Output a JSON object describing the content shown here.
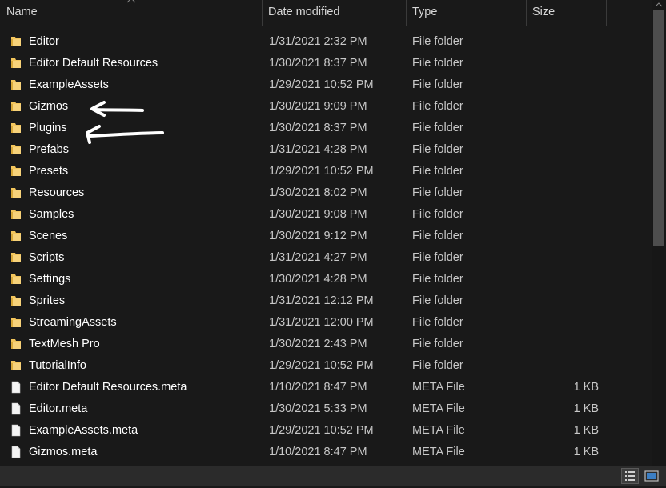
{
  "columns": {
    "name": "Name",
    "date": "Date modified",
    "type": "Type",
    "size": "Size"
  },
  "files": [
    {
      "name": "Editor",
      "date": "1/31/2021 2:32 PM",
      "type": "File folder",
      "size": "",
      "icon": "folder-icon"
    },
    {
      "name": "Editor Default Resources",
      "date": "1/30/2021 8:37 PM",
      "type": "File folder",
      "size": "",
      "icon": "folder-icon"
    },
    {
      "name": "ExampleAssets",
      "date": "1/29/2021 10:52 PM",
      "type": "File folder",
      "size": "",
      "icon": "folder-icon"
    },
    {
      "name": "Gizmos",
      "date": "1/30/2021 9:09 PM",
      "type": "File folder",
      "size": "",
      "icon": "folder-icon"
    },
    {
      "name": "Plugins",
      "date": "1/30/2021 8:37 PM",
      "type": "File folder",
      "size": "",
      "icon": "folder-icon"
    },
    {
      "name": "Prefabs",
      "date": "1/31/2021 4:28 PM",
      "type": "File folder",
      "size": "",
      "icon": "folder-icon"
    },
    {
      "name": "Presets",
      "date": "1/29/2021 10:52 PM",
      "type": "File folder",
      "size": "",
      "icon": "folder-icon"
    },
    {
      "name": "Resources",
      "date": "1/30/2021 8:02 PM",
      "type": "File folder",
      "size": "",
      "icon": "folder-icon"
    },
    {
      "name": "Samples",
      "date": "1/30/2021 9:08 PM",
      "type": "File folder",
      "size": "",
      "icon": "folder-icon"
    },
    {
      "name": "Scenes",
      "date": "1/30/2021 9:12 PM",
      "type": "File folder",
      "size": "",
      "icon": "folder-icon"
    },
    {
      "name": "Scripts",
      "date": "1/31/2021 4:27 PM",
      "type": "File folder",
      "size": "",
      "icon": "folder-icon"
    },
    {
      "name": "Settings",
      "date": "1/30/2021 4:28 PM",
      "type": "File folder",
      "size": "",
      "icon": "folder-icon"
    },
    {
      "name": "Sprites",
      "date": "1/31/2021 12:12 PM",
      "type": "File folder",
      "size": "",
      "icon": "folder-icon"
    },
    {
      "name": "StreamingAssets",
      "date": "1/31/2021 12:00 PM",
      "type": "File folder",
      "size": "",
      "icon": "folder-icon"
    },
    {
      "name": "TextMesh Pro",
      "date": "1/30/2021 2:43 PM",
      "type": "File folder",
      "size": "",
      "icon": "folder-icon"
    },
    {
      "name": "TutorialInfo",
      "date": "1/29/2021 10:52 PM",
      "type": "File folder",
      "size": "",
      "icon": "folder-icon"
    },
    {
      "name": "Editor Default Resources.meta",
      "date": "1/10/2021 8:47 PM",
      "type": "META File",
      "size": "1 KB",
      "icon": "file-icon"
    },
    {
      "name": "Editor.meta",
      "date": "1/30/2021 5:33 PM",
      "type": "META File",
      "size": "1 KB",
      "icon": "file-icon"
    },
    {
      "name": "ExampleAssets.meta",
      "date": "1/29/2021 10:52 PM",
      "type": "META File",
      "size": "1 KB",
      "icon": "file-icon"
    },
    {
      "name": "Gizmos.meta",
      "date": "1/10/2021 8:47 PM",
      "type": "META File",
      "size": "1 KB",
      "icon": "file-icon"
    }
  ],
  "colors": {
    "background": "#191919",
    "folder": "#f2c55c",
    "file": "#e8e8e8",
    "annotation": "#ffffff"
  },
  "icons": {
    "sort": "chevron-up-icon",
    "view_details": "details-view-icon",
    "view_tiles": "large-icons-view-icon"
  }
}
